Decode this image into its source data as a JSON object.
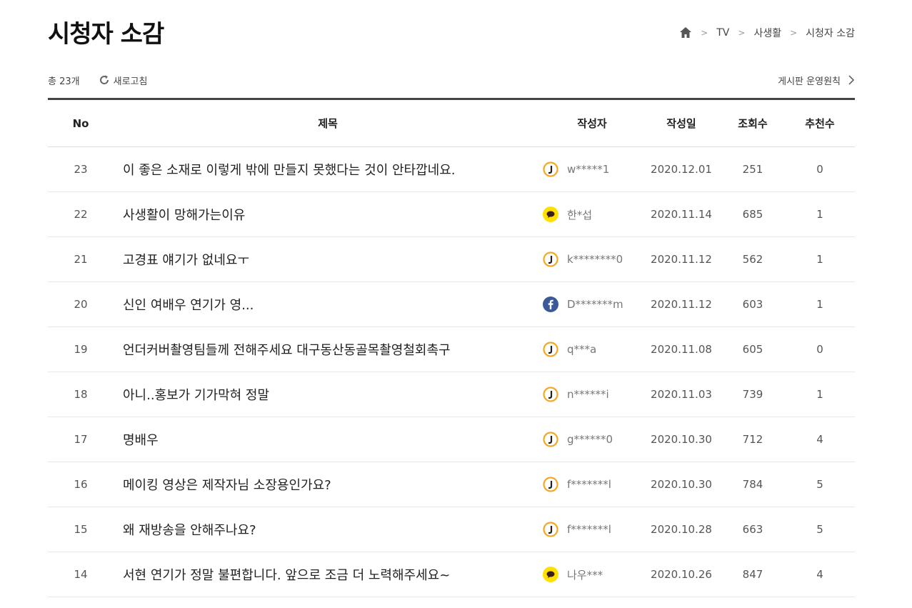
{
  "header": {
    "title": "시청자 소감"
  },
  "breadcrumb": {
    "items": [
      "TV",
      "사생활",
      "시청자 소감"
    ]
  },
  "toolbar": {
    "total": "총 23개",
    "refresh_label": "새로고침",
    "rules_label": "게시판 운영원칙"
  },
  "colors": {
    "jtbc": "#f5a623",
    "kakao": "#ffe000",
    "facebook": "#3b5998"
  },
  "table": {
    "headers": {
      "no": "No",
      "title": "제목",
      "author": "작성자",
      "date": "작성일",
      "views": "조회수",
      "likes": "추천수"
    },
    "rows": [
      {
        "no": "23",
        "title": "이 좋은 소재로 이렇게 밖에 만들지 못했다는 것이 안타깝네요.",
        "author": "w*****1",
        "login": "jtbc-icon",
        "date": "2020.12.01",
        "views": "251",
        "likes": "0"
      },
      {
        "no": "22",
        "title": "사생활이 망해가는이유",
        "author": "한*섭",
        "login": "kakao-icon",
        "date": "2020.11.14",
        "views": "685",
        "likes": "1"
      },
      {
        "no": "21",
        "title": "고경표 얘기가 없네요ㅜ",
        "author": "k********0",
        "login": "jtbc-icon",
        "date": "2020.11.12",
        "views": "562",
        "likes": "1"
      },
      {
        "no": "20",
        "title": "신인 여배우 연기가 영...",
        "author": "D*******m",
        "login": "facebook-icon",
        "date": "2020.11.12",
        "views": "603",
        "likes": "1"
      },
      {
        "no": "19",
        "title": "언더커버촬영팀들께 전해주세요 대구동산동골목촬영철회촉구",
        "author": "q***a",
        "login": "jtbc-icon",
        "date": "2020.11.08",
        "views": "605",
        "likes": "0"
      },
      {
        "no": "18",
        "title": "아니..홍보가 기가막혀 정말",
        "author": "n******i",
        "login": "jtbc-icon",
        "date": "2020.11.03",
        "views": "739",
        "likes": "1"
      },
      {
        "no": "17",
        "title": "명배우",
        "author": "g******0",
        "login": "jtbc-icon",
        "date": "2020.10.30",
        "views": "712",
        "likes": "4"
      },
      {
        "no": "16",
        "title": "메이킹 영상은 제작자님 소장용인가요?",
        "author": "f*******l",
        "login": "jtbc-icon",
        "date": "2020.10.30",
        "views": "784",
        "likes": "5"
      },
      {
        "no": "15",
        "title": "왜 재방송을 안해주나요?",
        "author": "f*******l",
        "login": "jtbc-icon",
        "date": "2020.10.28",
        "views": "663",
        "likes": "5"
      },
      {
        "no": "14",
        "title": "서현 연기가 정말 불편합니다. 앞으로 조금 더 노력해주세요~",
        "author": "나우***",
        "login": "kakao-icon",
        "date": "2020.10.26",
        "views": "847",
        "likes": "4"
      }
    ]
  }
}
